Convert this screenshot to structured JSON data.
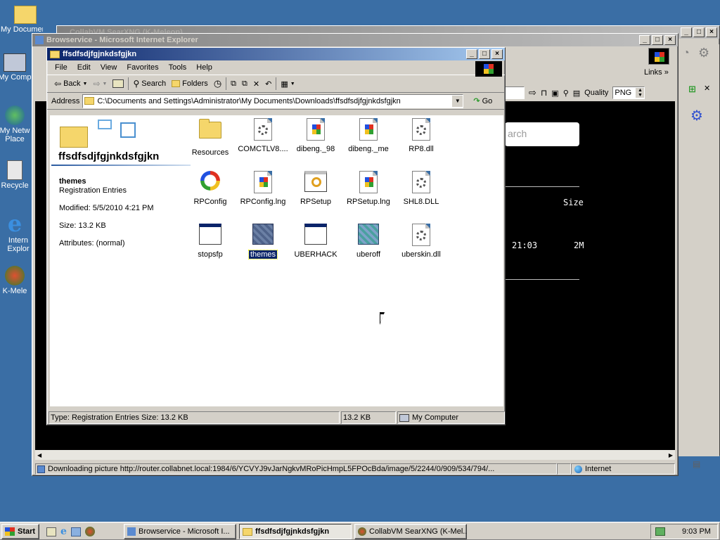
{
  "desktop": {
    "icons": [
      {
        "label": "My Documen"
      },
      {
        "label": "My Comp"
      },
      {
        "label": "My Netw Place"
      },
      {
        "label": "Recycle"
      },
      {
        "label": "Intern Explor"
      },
      {
        "label": "K-Mele"
      }
    ]
  },
  "back_window": {
    "title": "CollabVM SearXNG (K-Meleon)"
  },
  "ie_window": {
    "title": "Browservice - Microsoft Internet Explorer",
    "links_label": "Links",
    "quality_label": "Quality",
    "quality_value": "PNG",
    "page": {
      "search_placeholder": "arch",
      "size_header": "Size",
      "row_time": "21:03",
      "row_size": "2M"
    },
    "status_text": "Downloading picture http://router.collabnet.local:1984/6/YCVYJ9vJarNgkvMRoPicHmpL5FPOcBda/image/5/2244/0/909/534/794/...",
    "status_zone": "Internet"
  },
  "explorer": {
    "title": "ffsdfsdjfgjnkdsfgjkn",
    "menu": [
      "File",
      "Edit",
      "View",
      "Favorites",
      "Tools",
      "Help"
    ],
    "toolbar": {
      "back": "Back",
      "search": "Search",
      "folders": "Folders"
    },
    "address_label": "Address",
    "address_value": "C:\\Documents and Settings\\Administrator\\My Documents\\Downloads\\ffsdfsdjfgjnkdsfgjkn",
    "go_label": "Go",
    "panel": {
      "folder_name": "ffsdfsdjfgjnkdsfgjkn",
      "item_name": "themes",
      "item_type": "Registration Entries",
      "modified": "Modified: 5/5/2010 4:21 PM",
      "size": "Size: 13.2 KB",
      "attributes": "Attributes: (normal)"
    },
    "files": [
      {
        "name": "Resources",
        "icon": "folder-icon"
      },
      {
        "name": "COMCTLV8....",
        "icon": "gear-doc-icon"
      },
      {
        "name": "dibeng._98",
        "icon": "flag-doc-icon"
      },
      {
        "name": "dibeng._me",
        "icon": "flag-doc-icon"
      },
      {
        "name": "RP8.dll",
        "icon": "gear-doc-icon"
      },
      {
        "name": "RPConfig",
        "icon": "ring-icon"
      },
      {
        "name": "RPConfig.lng",
        "icon": "flag-doc-icon"
      },
      {
        "name": "RPSetup",
        "icon": "window-icon"
      },
      {
        "name": "RPSetup.lng",
        "icon": "flag-doc-icon"
      },
      {
        "name": "SHL8.DLL",
        "icon": "gear-doc-icon"
      },
      {
        "name": "stopsfp",
        "icon": "window-icon"
      },
      {
        "name": "themes",
        "icon": "registry-cube-icon",
        "selected": true
      },
      {
        "name": "UBERHACK",
        "icon": "window-icon"
      },
      {
        "name": "uberoff",
        "icon": "registry-cube-icon"
      },
      {
        "name": "uberskin.dll",
        "icon": "gear-doc-icon"
      }
    ],
    "status": {
      "info": "Type: Registration Entries Size: 13.2 KB",
      "size": "13.2 KB",
      "zone": "My Computer"
    }
  },
  "taskbar": {
    "start": "Start",
    "tasks": [
      {
        "label": "Browservice - Microsoft I..."
      },
      {
        "label": "ffsdfsdjfgjnkdsfgjkn"
      },
      {
        "label": "CollabVM SearXNG (K-Mel..."
      }
    ],
    "clock": "9:03 PM"
  }
}
